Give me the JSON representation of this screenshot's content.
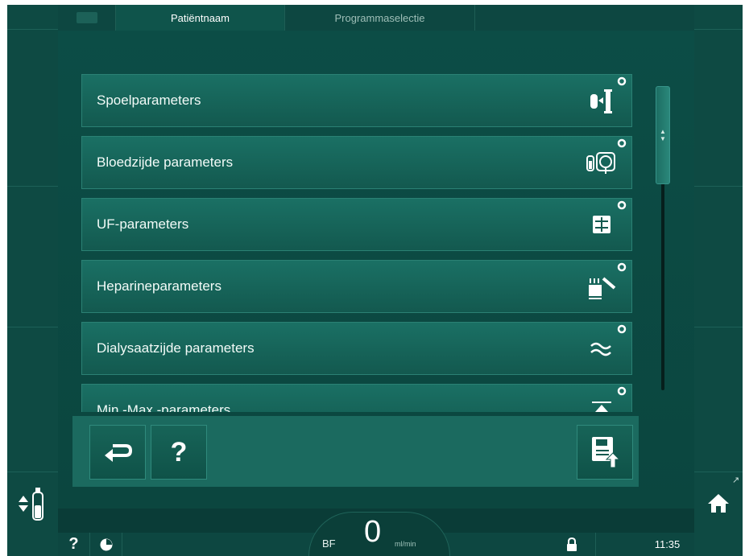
{
  "tabs": {
    "patient_name": "Patiëntnaam",
    "program_selection": "Programmaselectie"
  },
  "menu": {
    "items": [
      {
        "label": "Spoelparameters",
        "icon": "rinse-params-icon"
      },
      {
        "label": "Bloedzijde parameters",
        "icon": "blood-side-icon"
      },
      {
        "label": "UF-parameters",
        "icon": "uf-params-icon"
      },
      {
        "label": "Heparineparameters",
        "icon": "heparin-syringe-icon"
      },
      {
        "label": "Dialysaatzijde parameters",
        "icon": "dialysate-wave-icon"
      },
      {
        "label": "Min.-Max.-parameters",
        "icon": "min-max-icon"
      }
    ]
  },
  "actions": {
    "back_icon": "back-arrow-icon",
    "help_label": "?",
    "save_icon": "save-upload-icon"
  },
  "status": {
    "help_label": "?",
    "bf_label": "BF",
    "bf_value": "0",
    "bf_unit": "ml/min",
    "time": "11:35"
  },
  "colors": {
    "background": "#0a3c37",
    "button": "#1a7064",
    "accent_text": "#ffffff"
  }
}
